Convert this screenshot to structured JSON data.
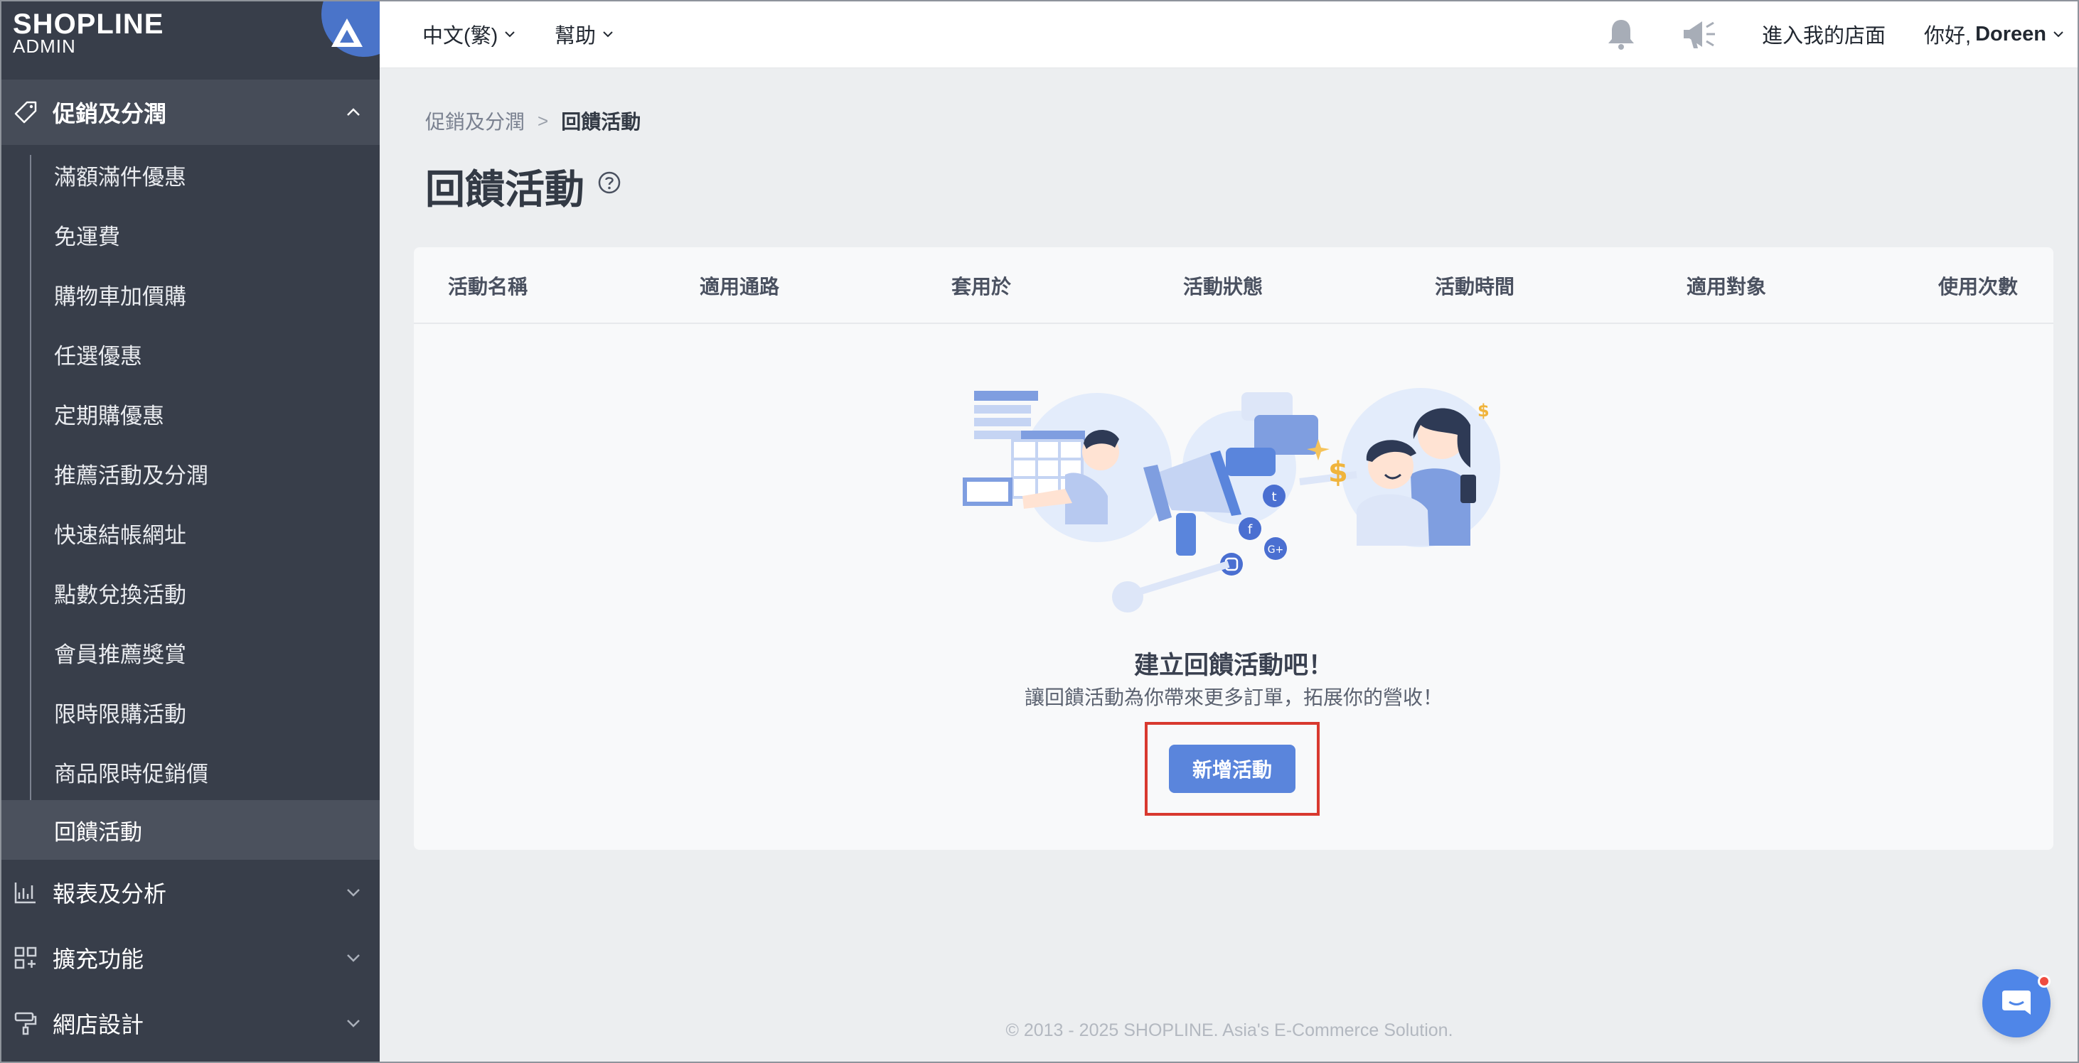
{
  "brand": {
    "logo_text": "SHOPLINE",
    "logo_sub": "ADMIN"
  },
  "sidebar": {
    "sections": [
      {
        "label": "促銷及分潤",
        "icon": "tag-icon",
        "expanded": true
      },
      {
        "label": "報表及分析",
        "icon": "chart-icon",
        "expanded": false
      },
      {
        "label": "擴充功能",
        "icon": "apps-icon",
        "expanded": false
      },
      {
        "label": "網店設計",
        "icon": "paint-roller-icon",
        "expanded": false
      }
    ],
    "items": [
      {
        "label": "滿額滿件優惠"
      },
      {
        "label": "免運費"
      },
      {
        "label": "購物車加價購"
      },
      {
        "label": "任選優惠"
      },
      {
        "label": "定期購優惠"
      },
      {
        "label": "推薦活動及分潤"
      },
      {
        "label": "快速結帳網址"
      },
      {
        "label": "點數兌換活動"
      },
      {
        "label": "會員推薦獎賞"
      },
      {
        "label": "限時限購活動"
      },
      {
        "label": "商品限時促銷價"
      },
      {
        "label": "回饋活動",
        "current": true
      }
    ]
  },
  "topbar": {
    "language": "中文(繁)",
    "help": "幫助",
    "store_link": "進入我的店面",
    "greeting": "你好, ",
    "user_name": "Doreen"
  },
  "breadcrumb": {
    "parent": "促銷及分潤",
    "separator": ">",
    "current": "回饋活動"
  },
  "page": {
    "title": "回饋活動"
  },
  "table": {
    "columns": [
      "活動名稱",
      "適用通路",
      "套用於",
      "活動狀態",
      "活動時間",
      "適用對象",
      "使用次數"
    ]
  },
  "empty_state": {
    "title": "建立回饋活動吧！",
    "subtitle": "讓回饋活動為你帶來更多訂單，拓展你的營收！",
    "button_label": "新增活動"
  },
  "footer": {
    "text": "© 2013 - 2025 SHOPLINE. Asia's E-Commerce Solution."
  },
  "colors": {
    "sidebar_bg": "#383e4a",
    "sidebar_active": "#464c58",
    "primary": "#5a85dc",
    "highlight": "#d8392f",
    "page_bg": "#eceef0"
  }
}
